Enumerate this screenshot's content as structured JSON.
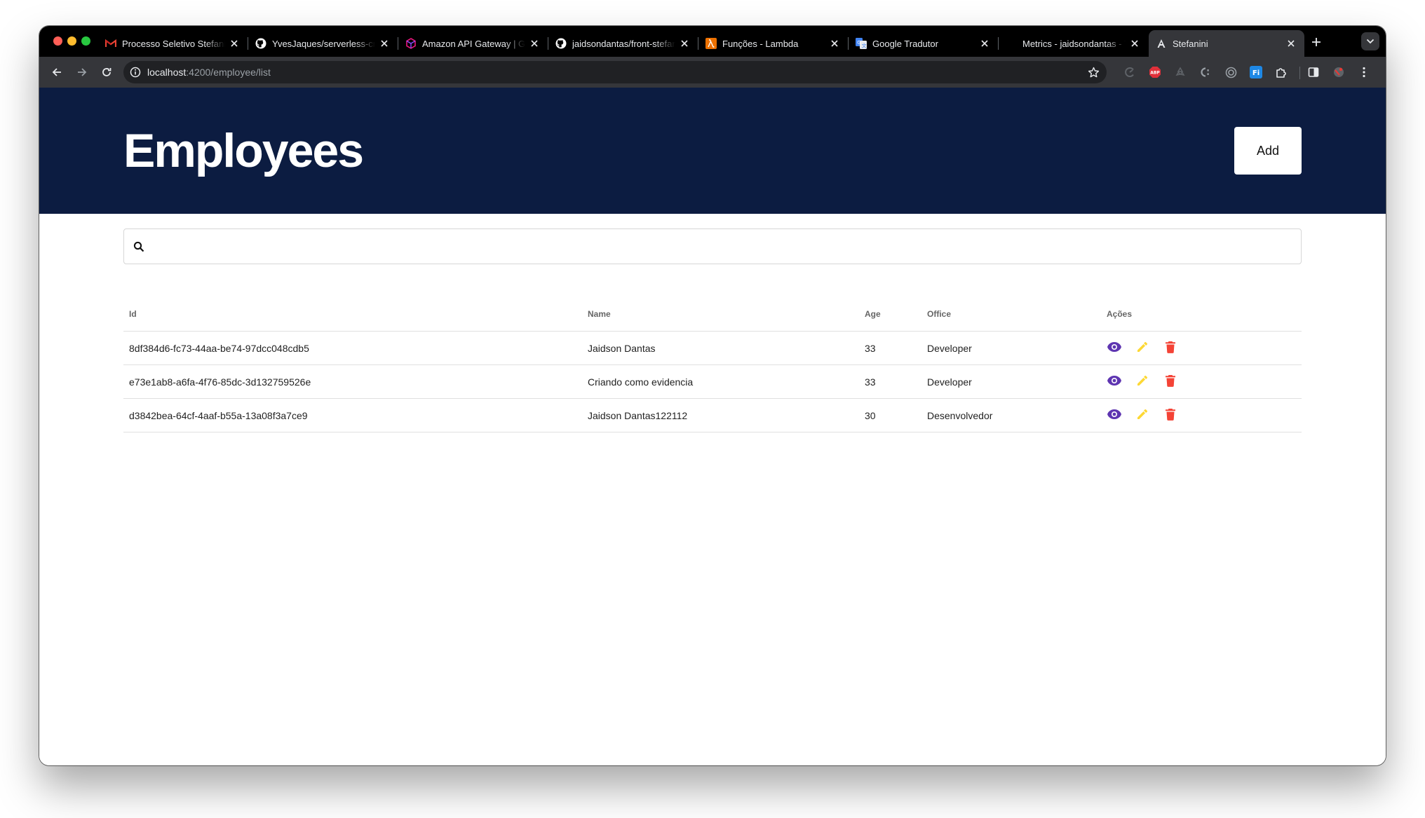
{
  "browser": {
    "tabs": [
      {
        "title": "Processo Seletivo Stefanini",
        "favicon": "gmail-icon",
        "active": false
      },
      {
        "title": "YvesJaques/serverless-crud",
        "favicon": "github-icon",
        "active": false
      },
      {
        "title": "Amazon API Gateway | Gerenciamento",
        "favicon": "api-gateway-icon",
        "active": false
      },
      {
        "title": "jaidsondantas/front-stefanini",
        "favicon": "github-icon",
        "active": false
      },
      {
        "title": "Funções - Lambda",
        "favicon": "lambda-icon",
        "active": false
      },
      {
        "title": "Google Tradutor",
        "favicon": "google-translate-icon",
        "active": false
      },
      {
        "title": "Metrics - jaidsondantas - Thunder",
        "favicon": "",
        "active": false
      },
      {
        "title": "Stefanini",
        "favicon": "angular-icon",
        "active": true
      }
    ],
    "url_host": "localhost",
    "url_path": ":4200/employee/list",
    "extensions": [
      "chrome-extension-icon",
      "adblock-plus-icon",
      "recycle-extension-icon",
      "css-extension-icon",
      "target-extension-icon",
      "fi-extension-icon",
      "puzzle-icon",
      "side-panel-icon",
      "profile-extension-icon",
      "more-vert-icon"
    ]
  },
  "header": {
    "title": "Employees",
    "add_label": "Add"
  },
  "search": {
    "value": "",
    "placeholder": ""
  },
  "table": {
    "columns": {
      "id": "Id",
      "name": "Name",
      "age": "Age",
      "office": "Office",
      "actions": "Ações"
    },
    "rows": [
      {
        "id": "8df384d6-fc73-44aa-be74-97dcc048cdb5",
        "name": "Jaidson Dantas",
        "age": "33",
        "office": "Developer"
      },
      {
        "id": "e73e1ab8-a6fa-4f76-85dc-3d132759526e",
        "name": "Criando como evidencia",
        "age": "33",
        "office": "Developer"
      },
      {
        "id": "d3842bea-64cf-4aaf-b55a-13a08f3a7ce9",
        "name": "Jaidson Dantas122112",
        "age": "30",
        "office": "Desenvolvedor"
      }
    ]
  },
  "colors": {
    "hero_bg": "#0c1c41",
    "view_icon": "#5e35b1",
    "edit_icon": "#fdd835",
    "delete_icon": "#f44336"
  }
}
